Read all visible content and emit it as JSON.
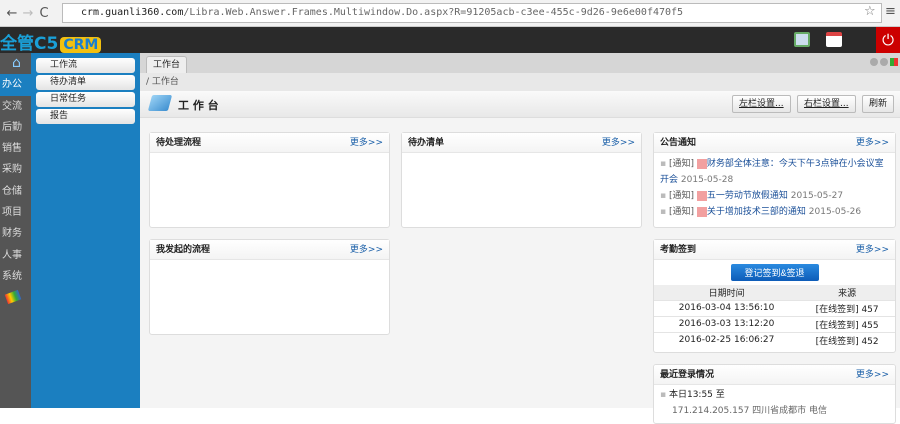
{
  "browser": {
    "url_host": "crm.guanli360.com",
    "url_path": "/Libra.Web.Answer.Frames.Multiwindow.Do.aspx?R=91205acb-c3ee-455c-9d26-9e6e00f470f5"
  },
  "app": {
    "logo_text": "全管C5",
    "logo_badge": "CRM"
  },
  "rail": [
    "办公",
    "交流",
    "后勤",
    "销售",
    "采购",
    "仓储",
    "项目",
    "财务",
    "人事",
    "系统"
  ],
  "submenu": [
    "工作流",
    "待办清单",
    "日常任务",
    "报告"
  ],
  "tab": "工作台",
  "breadcrumb": "/ 工作台",
  "page_title": "工 作 台",
  "toolbar": {
    "left": "左栏设置...",
    "right": "右栏设置...",
    "refresh": "刷新"
  },
  "more": "更多>>",
  "panels": {
    "pending": "待处理流程",
    "todo": "待办清单",
    "mine": "我发起的流程",
    "notice": "公告通知",
    "attendance": "考勤签到",
    "login": "最近登录情况"
  },
  "notices": [
    {
      "tag": "[通知]",
      "title": "财务部全体注意：今天下午3点钟在小会议室开会",
      "date": "2015-05-28"
    },
    {
      "tag": "[通知]",
      "title": "五一劳动节放假通知",
      "date": "2015-05-27"
    },
    {
      "tag": "[通知]",
      "title": "关于增加技术三部的通知",
      "date": "2015-05-26"
    }
  ],
  "attendance": {
    "button": "登记签到&签退",
    "headers": [
      "日期时间",
      "来源"
    ],
    "rows": [
      [
        "2016-03-04 13:56:10",
        "[在线签到] 457"
      ],
      [
        "2016-03-03 13:12:20",
        "[在线签到] 455"
      ],
      [
        "2016-02-25 16:06:27",
        "[在线签到] 452"
      ]
    ]
  },
  "login": {
    "line1": "本日13:55 至",
    "line2": "171.214.205.157 四川省成都市 电信"
  }
}
